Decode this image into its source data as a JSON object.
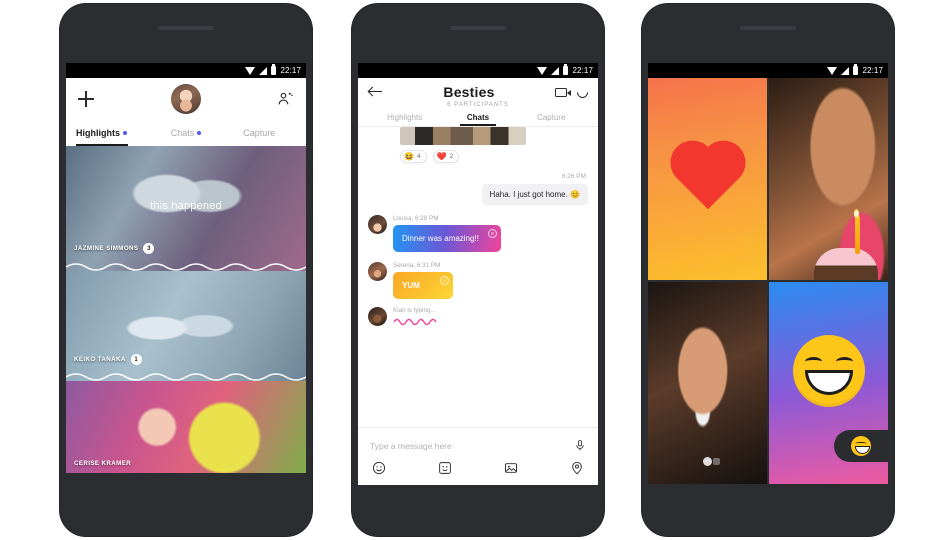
{
  "meta": {
    "app": "Skype",
    "bg_color": "#ffffff",
    "phone_frame_color": "#2b2d31"
  },
  "statusbar": {
    "time": "22:17"
  },
  "phone1": {
    "topbar": {
      "add_label": "+",
      "avatar_name": "avatar"
    },
    "tabs": [
      {
        "label": "Highlights",
        "active": true,
        "dot": true
      },
      {
        "label": "Chats",
        "active": false,
        "dot": true
      },
      {
        "label": "Capture",
        "active": false,
        "dot": false
      }
    ],
    "caption": "this happened",
    "highlights": [
      {
        "name": "JAZMINE SIMMONS",
        "count": "3"
      },
      {
        "name": "KEIKO TANAKA",
        "count": "1"
      },
      {
        "name": "CERISE KRAMER",
        "count": ""
      }
    ]
  },
  "phone2": {
    "header": {
      "title": "Besties",
      "subtitle": "6 PARTICIPANTS",
      "back_icon": "back-arrow-icon",
      "video_icon": "video-call-icon",
      "call_icon": "audio-call-icon"
    },
    "tabs": [
      {
        "label": "Highlights",
        "active": false
      },
      {
        "label": "Chats",
        "active": true
      },
      {
        "label": "Capture",
        "active": false
      }
    ],
    "reactions": [
      {
        "emoji": "😆",
        "count": "4"
      },
      {
        "emoji": "❤️",
        "count": "2"
      }
    ],
    "outgoing": {
      "timestamp": "6:26 PM",
      "text": "Haha. I just got home. 😊"
    },
    "messages": [
      {
        "sender": "Louisa",
        "meta": "Louisa, 6:28 PM",
        "text": "Dinner was amazing!!",
        "style": "blue-pink",
        "badge": "≡"
      },
      {
        "sender": "Serena",
        "meta": "Serena, 6:31 PM",
        "text": "YUM",
        "style": "gold",
        "badge": "≡"
      }
    ],
    "typing": {
      "meta": "Kian is typing...",
      "wave_color": "#f0449b"
    },
    "composer": {
      "placeholder": "Type a message here",
      "mic_icon": "microphone-icon",
      "tools": [
        "emoji-icon",
        "sticker-icon",
        "image-icon",
        "location-icon"
      ]
    }
  },
  "phone3": {
    "tiles": [
      {
        "name": "heart-reaction-tile",
        "kind": "heart"
      },
      {
        "name": "participant-video-tile-1",
        "kind": "video"
      },
      {
        "name": "participant-video-tile-2",
        "kind": "video"
      },
      {
        "name": "emoji-reaction-tile",
        "kind": "emoji"
      }
    ],
    "fab": {
      "name": "reaction-fab",
      "emoji": "😁"
    }
  }
}
